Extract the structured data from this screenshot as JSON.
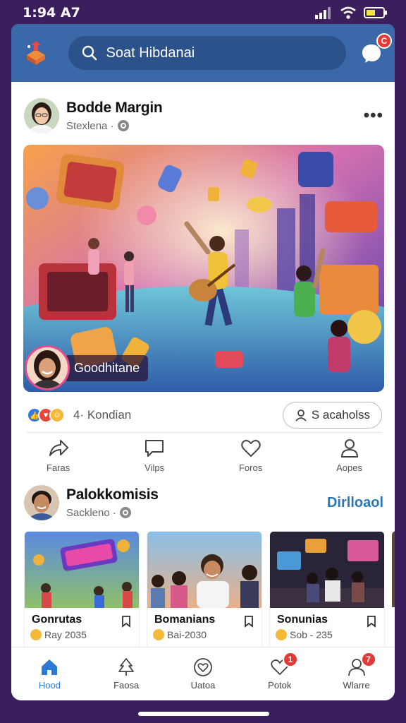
{
  "status_bar": {
    "time": "1:94 A7"
  },
  "header": {
    "search_placeholder": "Soat Hibdanai",
    "messages_badge": "C",
    "accent_color": "#3a68a8"
  },
  "post": {
    "author": "Bodde Margin",
    "subtitle": "Stexlena ·",
    "more": "•••",
    "hero_caption": "Goodhitane",
    "reactions_count": "4· Kondian",
    "shares_button": "S acaholss",
    "actions": [
      {
        "icon": "share-icon",
        "label": "Faras"
      },
      {
        "icon": "comment-icon",
        "label": "Vilps"
      },
      {
        "icon": "heart-icon",
        "label": "Foros"
      },
      {
        "icon": "person-icon",
        "label": "Aopes"
      }
    ]
  },
  "suggestions": {
    "author": "Palokkomisis",
    "subtitle": "Sackleno ·",
    "link": "Dirlloaol",
    "tiles": [
      {
        "title": "Gonrutas",
        "meta": "Ray 2035"
      },
      {
        "title": "Bomanians",
        "meta": "Bai-2030"
      },
      {
        "title": "Sonunias",
        "meta": "Sob - 235"
      }
    ]
  },
  "bottom_nav": {
    "items": [
      {
        "label": "Hood",
        "icon": "home-icon",
        "active": true
      },
      {
        "label": "Faosa",
        "icon": "tree-icon"
      },
      {
        "label": "Uatoa",
        "icon": "heart-outline-icon"
      },
      {
        "label": "Potok",
        "icon": "heart-icon",
        "badge": "1"
      },
      {
        "label": "Wlarre",
        "icon": "person-icon",
        "badge": "7"
      }
    ]
  }
}
